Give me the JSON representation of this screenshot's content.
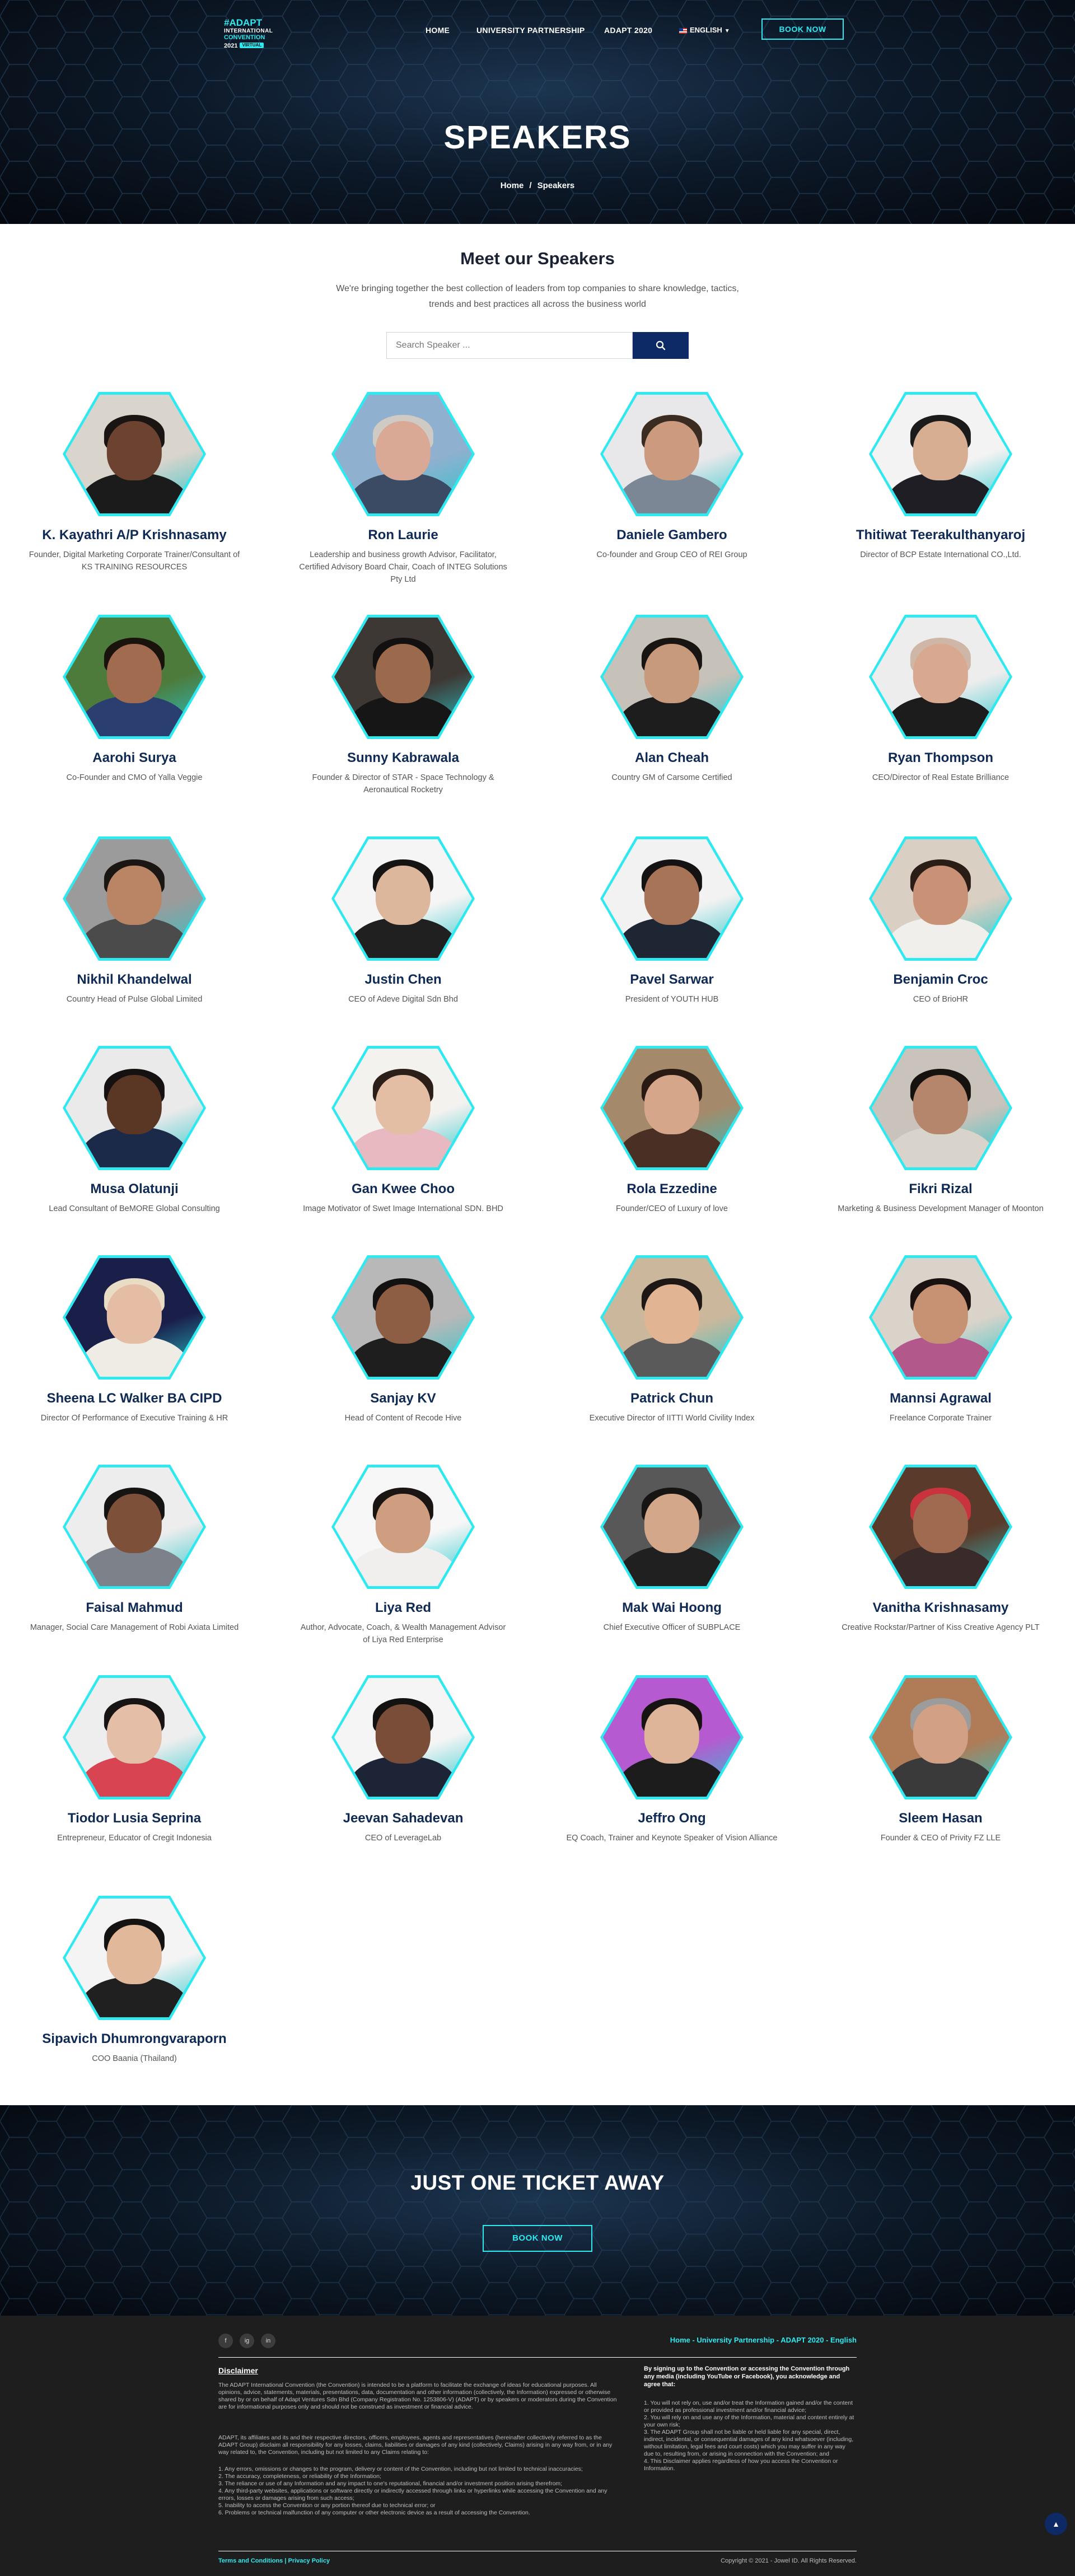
{
  "logo": {
    "line1": "#ADAPT",
    "line2": "INTERNATIONAL",
    "line3": "CONVENTION",
    "line4": "2021",
    "badge": "VIRTUAL"
  },
  "nav": {
    "home": "HOME",
    "partnership": "UNIVERSITY PARTNERSHIP",
    "adapt": "ADAPT 2020",
    "language": "ENGLISH",
    "book": "BOOK NOW"
  },
  "hero": {
    "title": "SPEAKERS",
    "crumb_home": "Home",
    "crumb_sep": "/",
    "crumb_current": "Speakers"
  },
  "intro": {
    "title": "Meet our Speakers",
    "subtitle": "We're bringing together the best collection of leaders from top companies to share knowledge, tactics, trends and best practices all across the business world"
  },
  "search": {
    "placeholder": "Search Speaker ..."
  },
  "speakers": [
    {
      "name": "K. Kayathri A/P Krishnasamy",
      "role": "Founder, Digital Marketing Corporate Trainer/Consultant of KS TRAINING RESOURCES",
      "bg": "#d9d4cc",
      "skin": "#6b4330",
      "hair": "#1a1412",
      "shirt": "#1b1b1b"
    },
    {
      "name": "Ron Laurie",
      "role": "Leadership and business growth Advisor, Facilitator, Certified Advisory Board Chair, Coach of INTEG Solutions Pty Ltd",
      "bg": "#8fb0cf",
      "skin": "#d9a995",
      "hair": "#cfcac3",
      "shirt": "#3a4b63"
    },
    {
      "name": "Daniele Gambero",
      "role": "Co-founder and Group CEO of REI Group",
      "bg": "#e8e8ea",
      "skin": "#cc9b7f",
      "hair": "#3b2c22",
      "shirt": "#7c8796"
    },
    {
      "name": "Thitiwat Teerakulthanyaroj",
      "role": "Director of BCP Estate International CO.,Ltd.",
      "bg": "#f3f3f3",
      "skin": "#d8ae92",
      "hair": "#1b1b1b",
      "shirt": "#1e1e24"
    },
    {
      "name": "Aarohi Surya",
      "role": "Co-Founder and CMO of Yalla Veggie",
      "bg": "#4d7b3c",
      "skin": "#a06b4f",
      "hair": "#1a120d",
      "shirt": "#2a3f70"
    },
    {
      "name": "Sunny Kabrawala",
      "role": "Founder & Director of STAR - Space Technology & Aeronautical Rocketry",
      "bg": "#3e3834",
      "skin": "#9b6a4c",
      "hair": "#121010",
      "shirt": "#161616"
    },
    {
      "name": "Alan Cheah",
      "role": "Country GM of Carsome Certified",
      "bg": "#c6c1b9",
      "skin": "#c79a7c",
      "hair": "#171412",
      "shirt": "#1d1d1d"
    },
    {
      "name": "Ryan Thompson",
      "role": "CEO/Director of Real Estate Brilliance",
      "bg": "#ededed",
      "skin": "#d9a891",
      "hair": "#cfb7a7",
      "shirt": "#1c1c1c"
    },
    {
      "name": "Nikhil Khandelwal",
      "role": "Country Head of Pulse Global Limited",
      "bg": "#9b9b9b",
      "skin": "#b98565",
      "hair": "#1a1614",
      "shirt": "#4b4b4b"
    },
    {
      "name": "Justin Chen",
      "role": "CEO of Adeve Digital Sdn Bhd",
      "bg": "#f5f5f5",
      "skin": "#ddb79c",
      "hair": "#161313",
      "shirt": "#202020"
    },
    {
      "name": "Pavel Sarwar",
      "role": "President of YOUTH HUB",
      "bg": "#f2f2f2",
      "skin": "#a87458",
      "hair": "#141212",
      "shirt": "#1f2633"
    },
    {
      "name": "Benjamin Croc",
      "role": "CEO of BrioHR",
      "bg": "#d9cfc2",
      "skin": "#c99176",
      "hair": "#2a1d16",
      "shirt": "#f0efec"
    },
    {
      "name": "Musa Olatunji",
      "role": "Lead Consultant of BeMORE Global Consulting",
      "bg": "#eaeaea",
      "skin": "#5a3624",
      "hair": "#151111",
      "shirt": "#1c2a4a"
    },
    {
      "name": "Gan Kwee Choo",
      "role": "Image Motivator of Swet Image International SDN. BHD",
      "bg": "#f4f2ef",
      "skin": "#e3bea5",
      "hair": "#2c1f19",
      "shirt": "#e9b9c1"
    },
    {
      "name": "Rola Ezzedine",
      "role": "Founder/CEO of Luxury of love",
      "bg": "#a48a6a",
      "skin": "#d6a68a",
      "hair": "#2a1a14",
      "shirt": "#4a2f24"
    },
    {
      "name": "Fikri Rizal",
      "role": "Marketing & Business Development Manager of Moonton",
      "bg": "#c9c3bb",
      "skin": "#b5866b",
      "hair": "#161210",
      "shirt": "#d8d4cc"
    },
    {
      "name": "Sheena LC Walker BA CIPD",
      "role": "Director Of Performance of Executive Training & HR",
      "bg": "#1a1f4a",
      "skin": "#e5bda4",
      "hair": "#e9dcc4",
      "shirt": "#efece6"
    },
    {
      "name": "Sanjay KV",
      "role": "Head of Content of Recode Hive",
      "bg": "#b8b8b8",
      "skin": "#8d5d44",
      "hair": "#141111",
      "shirt": "#1e1e1e"
    },
    {
      "name": "Patrick Chun",
      "role": "Executive Director of IITTI World Civility Index",
      "bg": "#cbb89c",
      "skin": "#e1b593",
      "hair": "#1d1816",
      "shirt": "#5a5a5a"
    },
    {
      "name": "Mannsi Agrawal",
      "role": "Freelance Corporate Trainer",
      "bg": "#d9d3c9",
      "skin": "#c79174",
      "hair": "#1a1210",
      "shirt": "#b2588a"
    },
    {
      "name": "Faisal Mahmud",
      "role": "Manager, Social Care Management of Robi Axiata Limited",
      "bg": "#ededed",
      "skin": "#7c5039",
      "hair": "#161313",
      "shirt": "#7d8189"
    },
    {
      "name": "Liya Red",
      "role": "Author, Advocate, Coach, & Wealth Management Advisor of Liya Red Enterprise",
      "bg": "#f7f7f7",
      "skin": "#cf9d80",
      "hair": "#1a1412",
      "shirt": "#f1eeee"
    },
    {
      "name": "Mak Wai Hoong",
      "role": "Chief Executive Officer of SUBPLACE",
      "bg": "#585858",
      "skin": "#d2a78a",
      "hair": "#171414",
      "shirt": "#202020"
    },
    {
      "name": "Vanitha Krishnasamy",
      "role": "Creative Rockstar/Partner of Kiss Creative Agency PLT",
      "bg": "#5a3a2a",
      "skin": "#a06a50",
      "hair": "#c8333e",
      "shirt": "#3b2a2a"
    },
    {
      "name": "Tiodor Lusia Seprina",
      "role": "Entrepreneur, Educator of Cregit Indonesia",
      "bg": "#eeeeee",
      "skin": "#e4bea6",
      "hair": "#191414",
      "shirt": "#d84451"
    },
    {
      "name": "Jeevan Sahadevan",
      "role": "CEO of LeverageLab",
      "bg": "#f5f5f5",
      "skin": "#7a4d38",
      "hair": "#141111",
      "shirt": "#1d2436"
    },
    {
      "name": "Jeffro Ong",
      "role": "EQ Coach, Trainer and Keynote Speaker of Vision Alliance",
      "bg": "#b65ad1",
      "skin": "#dfb599",
      "hair": "#171313",
      "shirt": "#1c1c1c"
    },
    {
      "name": "Sleem Hasan",
      "role": "Founder & CEO of Privity FZ LLE",
      "bg": "#b07b57",
      "skin": "#d2a185",
      "hair": "#9c9c9c",
      "shirt": "#3a3a3a"
    },
    {
      "name": "Sipavich Dhumrongvaraporn",
      "role": "COO Baania (Thailand)",
      "bg": "#f4f4f4",
      "skin": "#e2b89b",
      "hair": "#151212",
      "shirt": "#202020"
    }
  ],
  "cta": {
    "title": "JUST ONE TICKET AWAY",
    "button": "BOOK NOW"
  },
  "footer": {
    "social": [
      "f",
      "ig",
      "in"
    ],
    "nav": "Home - University Partnership - ADAPT 2020 - English",
    "disclaimer_title": "Disclaimer",
    "disclaimer_p1": "The ADAPT International Convention (the Convention) is intended to be a platform to facilitate the exchange of ideas for educational purposes. All opinions, advice, statements, materials, presentations, data, documentation and other information (collectively, the Information) expressed or otherwise shared by or on behalf of Adapt Ventures Sdn Bhd (Company Registration No. 1253806-V) (ADAPT) or by speakers or moderators during the Convention are for informational purposes only and should not be construed as investment or financial advice.",
    "disclaimer_p2": "ADAPT, its affiliates and its and their respective directors, officers, employees, agents and representatives (hereinafter collectively referred to as the ADAPT Group) disclaim all responsibility for any losses, claims, liabilities or damages of any kind (collectively, Claims) arising in any way from, or in any way related to, the Convention, including but not limited to any Claims relating to:",
    "disclaimer_list": "1. Any errors, omissions or changes to the program, delivery or content of the Convention, including but not limited to technical inaccuracies;\n2. The accuracy, completeness, or reliability of the Information;\n3. The reliance or use of any Information and any impact to one's reputational, financial and/or investment position arising therefrom;\n4. Any third-party websites, applications or software directly or indirectly accessed through links or hyperlinks while accessing the Convention and any errors, losses or damages arising from such access;\n5. Inability to access the Convention or any portion thereof due to technical error; or\n6. Problems or technical malfunction of any computer or other electronic device as a result of accessing the Convention.",
    "right_lead": "By signing up to the Convention or accessing the Convention through any media (including YouTube or Facebook), you acknowledge and agree that:",
    "right_list": "1. You will not rely on, use and/or treat the Information gained and/or the content or provided as professional investment and/or financial advice;\n2. You will rely on and use any of the Information, material and content entirely at your own risk;\n3. The ADAPT Group shall not be liable or held liable for any special, direct, indirect, incidental, or consequential damages of any kind whatsoever (including, without limitation, legal fees and court costs) which you may suffer in any way due to, resulting from, or arising in connection with the Convention; and\n4. This Disclaimer applies regardless of how you access the Convention or Information.",
    "links": "Terms and Conditions | Privacy Policy",
    "copyright": "Copyright © 2021 - Jowel ID. All Rights Reserved."
  }
}
